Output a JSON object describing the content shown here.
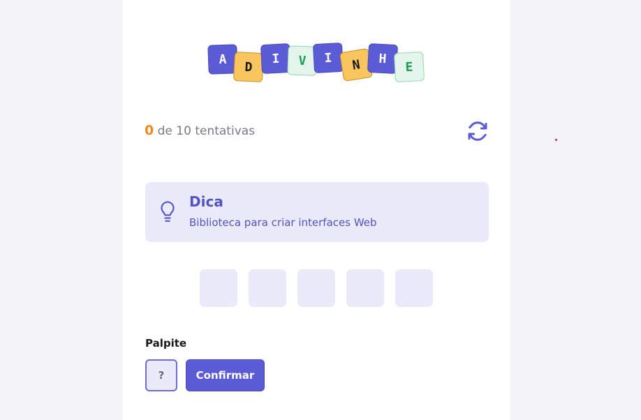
{
  "logo": {
    "letters": [
      "A",
      "D",
      "I",
      "V",
      "I",
      "N",
      "H",
      "E"
    ]
  },
  "status": {
    "attempts_used": "0",
    "attempts_text": "de 10 tentativas"
  },
  "hint": {
    "title": "Dica",
    "text": "Biblioteca para criar interfaces Web",
    "icon": "lightbulb-icon"
  },
  "answer": {
    "slot_count": 5
  },
  "guess": {
    "label": "Palpite",
    "placeholder": "?",
    "confirm_label": "Confirmar"
  },
  "colors": {
    "accent": "#5b5bd6",
    "counter": "#f08a1c",
    "hint_bg": "#ebeafa"
  }
}
